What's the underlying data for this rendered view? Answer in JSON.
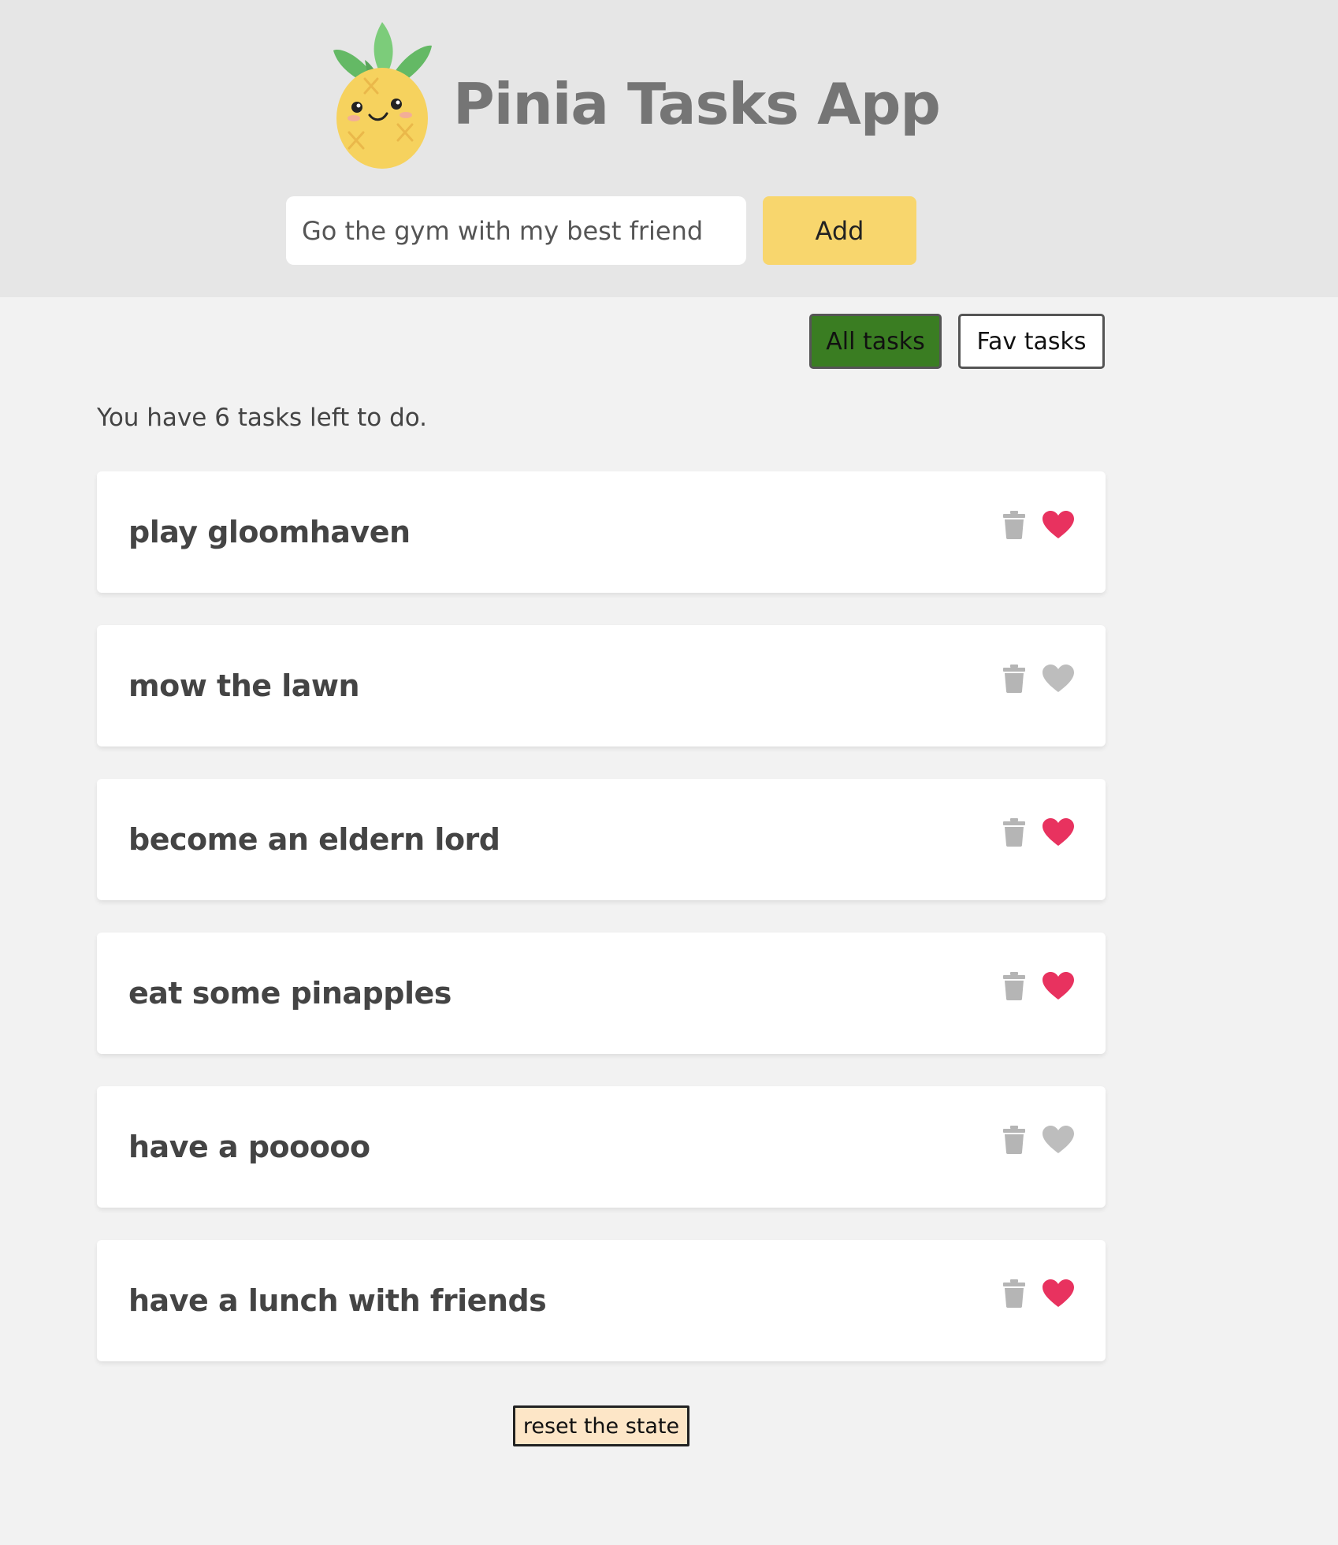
{
  "header": {
    "title": "Pinia Tasks App",
    "logo_icon": "pineapple-logo-icon"
  },
  "new_task": {
    "value": "Go the gym with my best friend",
    "add_label": "Add"
  },
  "filters": {
    "all_label": "All tasks",
    "fav_label": "Fav tasks",
    "active": "all"
  },
  "summary": {
    "text": "You have 6 tasks left to do."
  },
  "tasks": [
    {
      "title": "play gloomhaven",
      "favorite": true
    },
    {
      "title": "mow the lawn",
      "favorite": false
    },
    {
      "title": "become an eldern lord",
      "favorite": true
    },
    {
      "title": "eat some pinapples",
      "favorite": true
    },
    {
      "title": "have a pooooo",
      "favorite": false
    },
    {
      "title": "have a lunch with friends",
      "favorite": true
    }
  ],
  "task_icons": {
    "delete": "trash-icon",
    "favorite": "heart-icon"
  },
  "reset": {
    "label": "reset the state"
  },
  "colors": {
    "header_bg": "#e6e6e6",
    "page_bg": "#f2f2f2",
    "add_button": "#f8d66d",
    "active_filter": "#3a7d22",
    "heart_on": "#e8325f",
    "heart_off": "#bdbdbd",
    "trash": "#b5b5b5",
    "reset_bg": "#fde6c7"
  }
}
